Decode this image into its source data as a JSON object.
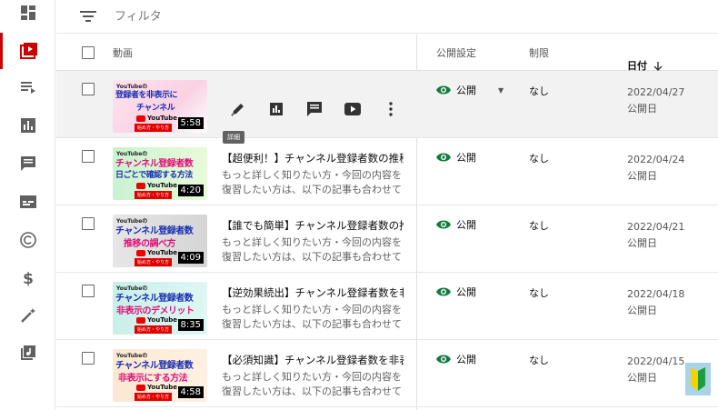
{
  "filter": {
    "placeholder": "フィルタ"
  },
  "table": {
    "headers": {
      "video": "動画",
      "visibility": "公開設定",
      "restriction": "制限",
      "date": "日付"
    },
    "hover_actions": {
      "tooltip": "詳細"
    },
    "rows": [
      {
        "duration": "5:58",
        "title": "",
        "desc1": "",
        "desc2": "",
        "visibility": "公開",
        "restriction": "なし",
        "date": "2022/04/27",
        "date_label": "公開日",
        "thumb": {
          "line1": "YouTubeの",
          "line2": "登録者を非表示に",
          "line3": "チャンネル",
          "tag": "始め方・やり方"
        }
      },
      {
        "duration": "4:20",
        "title": "【超便利！】チャンネル登録者数の推移を",
        "desc1": "もっと詳しく知りたい方・今回の内容を",
        "desc2": "復習したい方は、以下の記事も合わせて",
        "visibility": "公開",
        "restriction": "なし",
        "date": "2022/04/24",
        "date_label": "公開日",
        "thumb": {
          "line1": "YouTubeの",
          "line2": "チャンネル登録者数",
          "line3": "日ごとで確認する方法",
          "tag": "始め方・やり方"
        }
      },
      {
        "duration": "4:09",
        "title": "【誰でも簡単】チャンネル登録者数の推移",
        "desc1": "もっと詳しく知りたい方・今回の内容を",
        "desc2": "復習したい方は、以下の記事も合わせて",
        "visibility": "公開",
        "restriction": "なし",
        "date": "2022/04/21",
        "date_label": "公開日",
        "thumb": {
          "line1": "YouTubeの",
          "line2": "チャンネル登録者数",
          "line3": "推移の調べ方",
          "tag": "始め方・やり方"
        }
      },
      {
        "duration": "8:35",
        "title": "【逆効果続出】チャンネル登録者数を非表示",
        "desc1": "もっと詳しく知りたい方・今回の内容を",
        "desc2": "復習したい方は、以下の記事も合わせて",
        "visibility": "公開",
        "restriction": "なし",
        "date": "2022/04/18",
        "date_label": "公開日",
        "thumb": {
          "line1": "YouTubeの",
          "line2": "チャンネル登録者数",
          "line3": "非表示のデメリット",
          "tag": "始め方・やり方"
        }
      },
      {
        "duration": "4:58",
        "title": "【必須知識】チャンネル登録者数を非表示に",
        "desc1": "もっと詳しく知りたい方・今回の内容を",
        "desc2": "復習したい方は、以下の記事も合わせて",
        "visibility": "公開",
        "restriction": "なし",
        "date": "2022/04/15",
        "date_label": "公開日",
        "thumb": {
          "line1": "YouTubeの",
          "line2": "チャンネル登録者数",
          "line3": "非表示にする方法",
          "tag": "始め方・やり方"
        }
      }
    ]
  },
  "colors": {
    "active": "#cc0000",
    "eye": "#0f7b3f"
  }
}
